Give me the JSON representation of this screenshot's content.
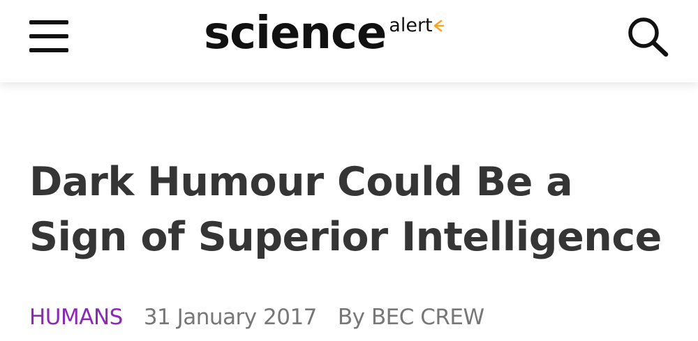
{
  "header": {
    "logo": {
      "main": "science",
      "sub": "alert"
    },
    "menu_icon": "hamburger-menu-icon",
    "search_icon": "search-icon",
    "accent_color": "#f5a623"
  },
  "article": {
    "title": "Dark Humour Could Be a Sign of Superior Intelligence",
    "category": "HUMANS",
    "category_color": "#8a29b4",
    "date": "31 January 2017",
    "byline_prefix": "By",
    "author": "BEC CREW"
  }
}
